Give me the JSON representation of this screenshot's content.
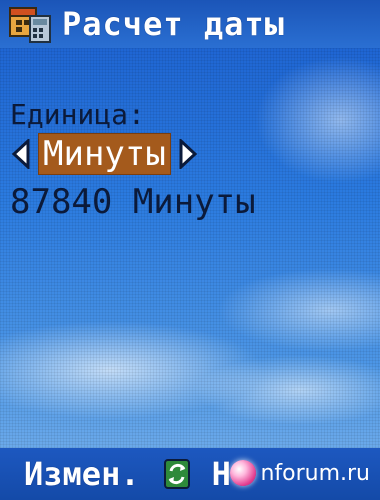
{
  "header": {
    "title": "Расчет даты",
    "app_icon": "calendar-calculator-icon"
  },
  "content": {
    "unit_label": "Единица:",
    "selected_unit": "Минуты",
    "result": "87840 Минуты"
  },
  "softkeys": {
    "left_label": "Измен.",
    "center_icon": "refresh-icon",
    "right_label": "Н"
  },
  "watermark": {
    "text": "nforum.ru"
  },
  "colors": {
    "background_blue": "#1d66d4",
    "selection": "#a45a1c",
    "text_dark": "#0b1a3a",
    "softkey_text": "#ffffff"
  }
}
